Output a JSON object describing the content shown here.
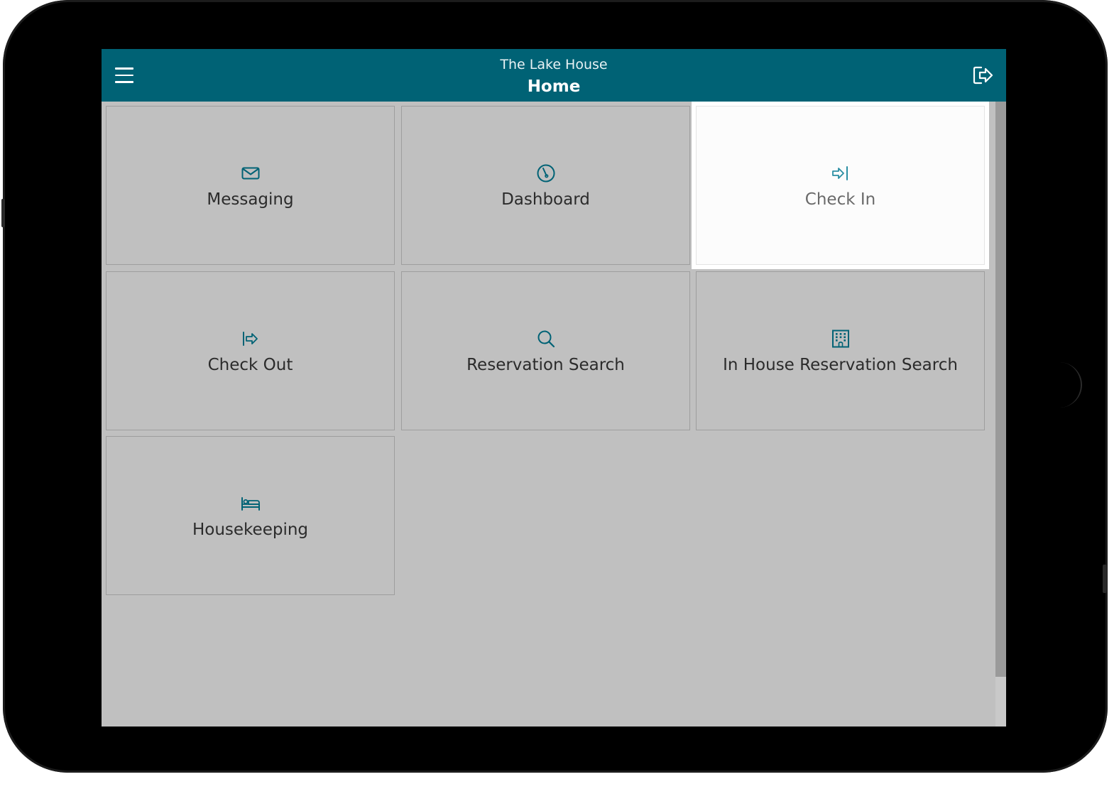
{
  "header": {
    "property_name": "The Lake House",
    "page_title": "Home",
    "menu_icon": "hamburger-menu-icon",
    "logout_icon": "logout-icon"
  },
  "colors": {
    "header_bg": "#006275",
    "accent": "#006275",
    "tile_bg": "#c0c0c0",
    "tile_active_bg": "#fcfcfc"
  },
  "tiles": [
    {
      "label": "Messaging",
      "icon": "envelope-icon",
      "active": false
    },
    {
      "label": "Dashboard",
      "icon": "gauge-icon",
      "active": false
    },
    {
      "label": "Check In",
      "icon": "check-in-icon",
      "active": true
    },
    {
      "label": "Check Out",
      "icon": "check-out-icon",
      "active": false
    },
    {
      "label": "Reservation Search",
      "icon": "search-icon",
      "active": false
    },
    {
      "label": "In House Reservation Search",
      "icon": "hotel-building-icon",
      "active": false
    },
    {
      "label": "Housekeeping",
      "icon": "bed-icon",
      "active": false
    }
  ]
}
